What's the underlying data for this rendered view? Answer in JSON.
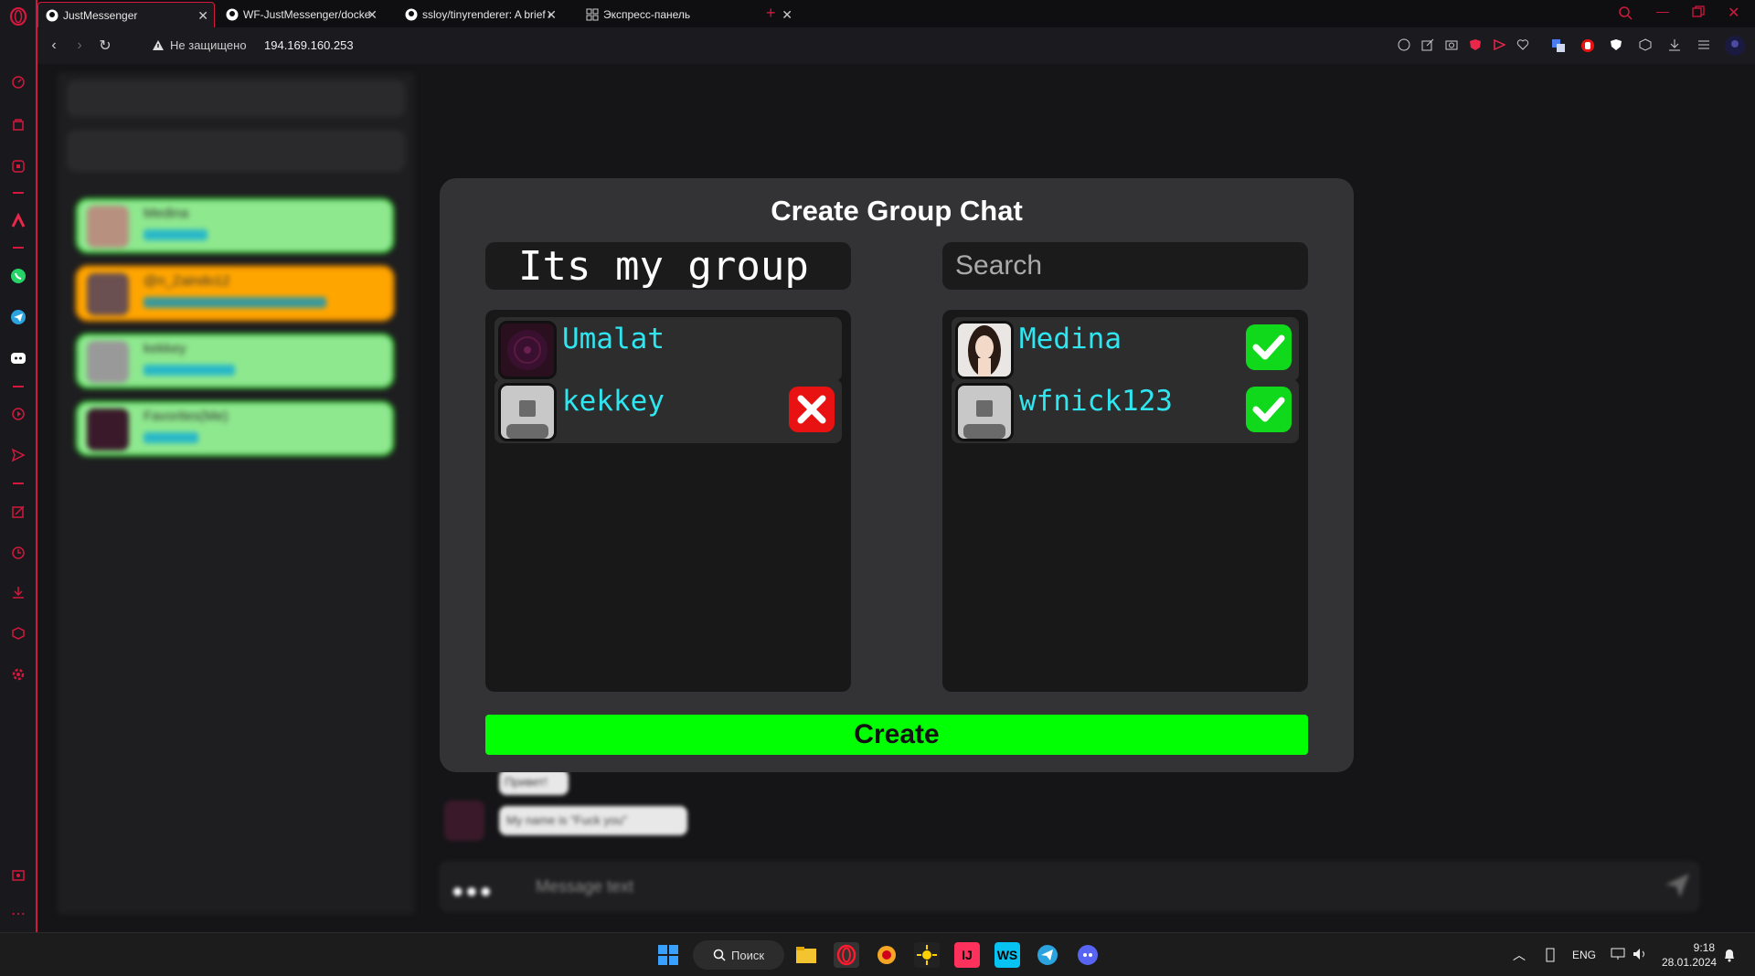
{
  "browser": {
    "tabs": [
      {
        "label": "JustMessenger"
      },
      {
        "label": "WF-JustMessenger/docker"
      },
      {
        "label": "ssloy/tinyrenderer: A brief c"
      },
      {
        "label": "Экспресс-панель"
      }
    ],
    "address": {
      "security_label": "Не защищено",
      "url": "194.169.160.253"
    }
  },
  "sidebar": {
    "chats": [
      {
        "name": "Medina",
        "color": "#8ee88e"
      },
      {
        "name": "@n_Zaindo12",
        "color": "#ffa500"
      },
      {
        "name": "kekkey",
        "color": "#8ee88e"
      },
      {
        "name": "Favorites(Me)",
        "color": "#8ee88e"
      }
    ]
  },
  "modal": {
    "title": "Create Group Chat",
    "group_name_value": "Its my group",
    "search_placeholder": "Search",
    "selected_members": [
      {
        "name": "Umalat",
        "action": "none"
      },
      {
        "name": "kekkey",
        "action": "remove"
      }
    ],
    "search_results": [
      {
        "name": "Medina",
        "action": "checked"
      },
      {
        "name": "wfnick123",
        "action": "checked"
      }
    ],
    "create_label": "Create"
  },
  "messages": [
    {
      "text": "Привет!"
    },
    {
      "text": "My name is \"Fuck you\""
    }
  ],
  "composer": {
    "placeholder": "Message text"
  },
  "taskbar": {
    "search_label": "Поиск",
    "language": "ENG",
    "time": "9:18",
    "date": "28.01.2024"
  },
  "colors": {
    "accent": "#d3183d",
    "create_green": "#03ff03",
    "name_cyan": "#2fe6f0",
    "check_green": "#10d81a",
    "remove_red": "#e81212"
  }
}
